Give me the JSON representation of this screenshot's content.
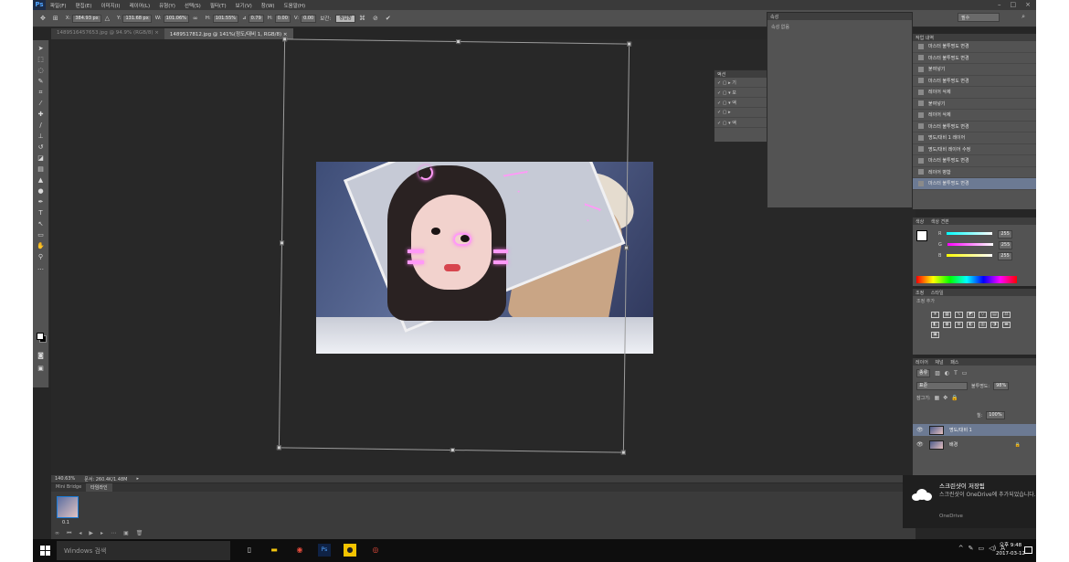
{
  "app": {
    "logo": "Ps",
    "menu": [
      "파일(F)",
      "편집(E)",
      "이미지(I)",
      "레이어(L)",
      "유형(Y)",
      "선택(S)",
      "필터(T)",
      "보기(V)",
      "창(W)",
      "도움말(H)"
    ],
    "window_controls": [
      "–",
      "□",
      "×"
    ]
  },
  "options_bar": {
    "x_label": "X:",
    "x_value": "384.93 px",
    "y_label": "Y:",
    "y_value": "131.68 px",
    "w_label": "W:",
    "w_value": "101.06%",
    "h_label": "H:",
    "h_value": "101.55%",
    "angle_label": "⊿",
    "angle_value": "0.79",
    "hskew_label": "H:",
    "hskew_value": "0.00",
    "vskew_label": "V:",
    "vskew_value": "0.00",
    "interp_label": "보간:",
    "interp_value": "쌍입방",
    "workspace": "필수"
  },
  "tabs": [
    {
      "label": "1489516457653.jpg @ 94.9% (RGB/8) ×",
      "active": false
    },
    {
      "label": "1489517812.jpg @ 141%(정도/대비 1, RGB/8) ×",
      "active": true
    }
  ],
  "status": {
    "zoom": "140.63%",
    "doc": "문서: 260.4K/1.48M"
  },
  "minibridge": {
    "tabs": [
      "Mini Bridge",
      "타임라인"
    ],
    "frame_delay": "0.1"
  },
  "actions_panel": {
    "title": "액션",
    "rows": [
      "▸ 기",
      "▾ 보",
      "▾ 액",
      "▸",
      "▾ 액"
    ]
  },
  "properties_panel": {
    "title": "속성",
    "subtitle": "속성 없음"
  },
  "history": {
    "title": "작업 내역",
    "items": [
      "마스터 불투명도 변경",
      "마스터 불투명도 변경",
      "붙여넣기",
      "마스터 불투명도 변경",
      "레이어 삭제",
      "붙여넣기",
      "레이어 삭제",
      "마스터 불투명도 변경",
      "명도/대비 1 레이어",
      "명도/대비 레이어 수정",
      "마스터 불투명도 변경",
      "레이어 병합",
      "마스터 불투명도 변경"
    ]
  },
  "color_panel": {
    "tabs": [
      "색상",
      "색상 견본"
    ],
    "r": "255",
    "g": "255",
    "b": "255"
  },
  "adjust_panel": {
    "tabs": [
      "조정",
      "스타일"
    ],
    "hint": "조정 추가"
  },
  "layers_panel": {
    "tabs": [
      "레이어",
      "채널",
      "패스"
    ],
    "kind": "종류",
    "blend": "표준",
    "opacity_label": "불투명도:",
    "opacity": "98%",
    "fill_label": "칠:",
    "fill": "100%",
    "lock_label": "잠그기:",
    "layers": [
      {
        "name": "명도/대비 1",
        "selected": true
      },
      {
        "name": "배경",
        "selected": false
      }
    ]
  },
  "toast": {
    "title": "스크린샷이 저장됨",
    "body": "스크린샷이 OneDrive에 추가되었습니다.",
    "app": "OneDrive"
  },
  "taskbar": {
    "search_placeholder": "Windows 검색",
    "time": "오후 9:48",
    "date": "2017-03-12",
    "input_lang": "A"
  },
  "colors": {
    "bg": "#262626",
    "panel": "#535353",
    "accent": "#6c7a93",
    "pink_glow": "#ff9af7"
  }
}
